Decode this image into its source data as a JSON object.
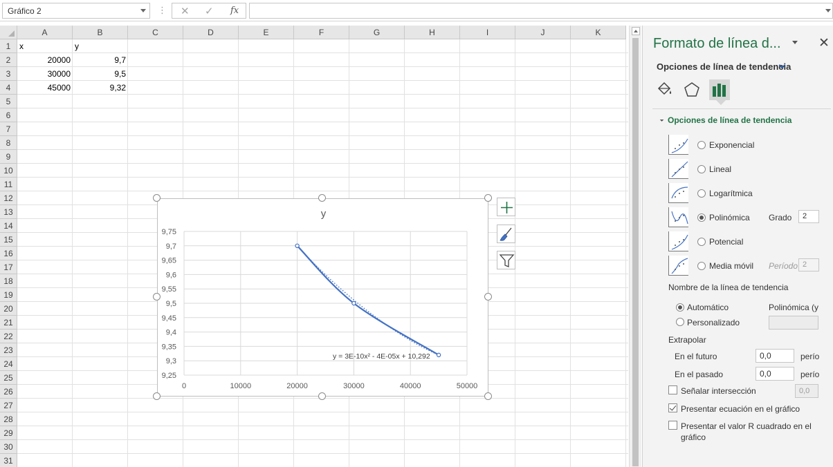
{
  "formula_bar": {
    "name_box": "Gráfico 2",
    "cancel_glyph": "✕",
    "enter_glyph": "✓",
    "fx_label": "fx",
    "formula": ""
  },
  "sheet": {
    "columns": [
      "A",
      "B",
      "C",
      "D",
      "E",
      "F",
      "G",
      "H",
      "I",
      "J",
      "K"
    ],
    "rows": [
      "1",
      "2",
      "3",
      "4",
      "5",
      "6",
      "7",
      "8",
      "9",
      "10",
      "11",
      "12",
      "13",
      "14",
      "15",
      "16",
      "17",
      "18",
      "19",
      "20",
      "21",
      "22",
      "23",
      "24",
      "25",
      "26",
      "27",
      "28",
      "29",
      "30",
      "31"
    ],
    "cells": {
      "A1": "x",
      "B1": "y",
      "A2": "20000",
      "B2": "9,7",
      "A3": "30000",
      "B3": "9,5",
      "A4": "45000",
      "B4": "9,32"
    }
  },
  "chart_data": {
    "type": "scatter",
    "title": "y",
    "x": [
      20000,
      30000,
      45000
    ],
    "y": [
      9.7,
      9.5,
      9.32
    ],
    "xlim": [
      0,
      50000
    ],
    "ylim": [
      9.25,
      9.75
    ],
    "x_ticks": [
      "0",
      "10000",
      "20000",
      "30000",
      "40000",
      "50000"
    ],
    "y_ticks": [
      "9,75",
      "9,7",
      "9,65",
      "9,6",
      "9,55",
      "9,5",
      "9,45",
      "9,4",
      "9,35",
      "9,3",
      "9,25"
    ],
    "grid": true,
    "line": "smooth",
    "series_color": "#4472C4",
    "trendline": {
      "type": "polynomial",
      "order": 2,
      "style": "dotted",
      "equation": "y = 3E-10x² - 4E-05x + 10,292"
    }
  },
  "pane": {
    "title": "Formato de línea d...",
    "close_glyph": "✕",
    "subtitle": "Opciones de línea de tendencia",
    "section": "Opciones de línea de tendencia",
    "accent": "#217346",
    "options": [
      {
        "label": "Exponencial",
        "selected": false
      },
      {
        "label": "Lineal",
        "selected": false
      },
      {
        "label": "Logarítmica",
        "selected": false
      },
      {
        "label": "Polinómica",
        "selected": true,
        "sub_label": "Grado",
        "value": "2"
      },
      {
        "label": "Potencial",
        "selected": false
      },
      {
        "label": "Media móvil",
        "selected": false,
        "sub_label": "Período",
        "value": "2"
      }
    ],
    "name_label": "Nombre de la línea de tendencia",
    "auto_label": "Automático",
    "auto_value": "Polinómica (y",
    "custom_label": "Personalizado",
    "extrapolate_label": "Extrapolar",
    "forward_label": "En el futuro",
    "forward_value": "0,0",
    "backward_label": "En el pasado",
    "backward_value": "0,0",
    "period_unit": "perío",
    "intercept_label": "Señalar intersección",
    "intercept_value": "0,0",
    "show_equation_label": "Presentar ecuación en el gráfico",
    "show_r2_label_1": "Presentar el valor R cuadrado en el",
    "show_r2_label_2": "gráfico"
  }
}
